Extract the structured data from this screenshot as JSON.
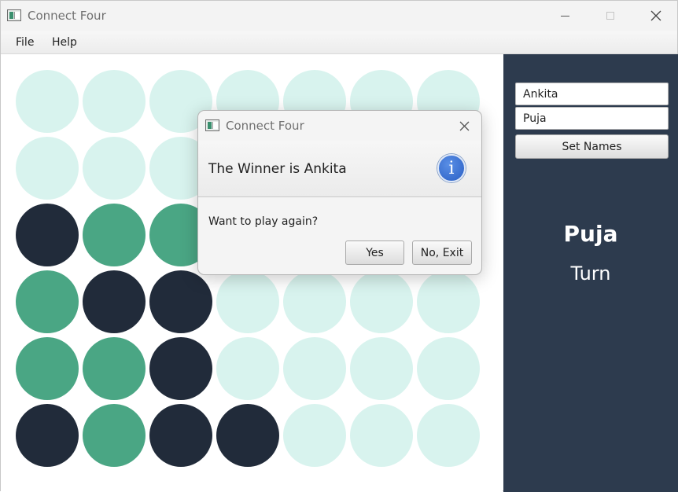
{
  "window": {
    "title": "Connect Four",
    "minimize_icon": "minimize-icon",
    "maximize_icon": "maximize-icon",
    "close_icon": "close-icon"
  },
  "menu": {
    "items": [
      {
        "label": "File"
      },
      {
        "label": "Help"
      }
    ]
  },
  "board": {
    "rows": 6,
    "columns": 7,
    "cells": [
      [
        "empty",
        "empty",
        "empty",
        "empty",
        "empty",
        "empty",
        "empty"
      ],
      [
        "empty",
        "empty",
        "empty",
        "empty",
        "empty",
        "empty",
        "empty"
      ],
      [
        "dark",
        "green",
        "green",
        "empty",
        "empty",
        "empty",
        "empty"
      ],
      [
        "green",
        "dark",
        "dark",
        "empty",
        "empty",
        "empty",
        "empty"
      ],
      [
        "green",
        "green",
        "dark",
        "empty",
        "empty",
        "empty",
        "empty"
      ],
      [
        "dark",
        "green",
        "dark",
        "dark",
        "empty",
        "empty",
        "empty"
      ]
    ],
    "colors": {
      "empty": "#d8f3ee",
      "green": "#4aa684",
      "dark": "#212b3a"
    }
  },
  "side_panel": {
    "player_one_value": "Ankita",
    "player_two_value": "Puja",
    "set_names_label": "Set Names",
    "current_player": "Puja",
    "turn_label": "Turn",
    "background": "#2d3b4e"
  },
  "dialog": {
    "title": "Connect Four",
    "header_text": "The Winner is Ankita",
    "info_icon_glyph": "i",
    "body_text": "Want to play again?",
    "yes_label": "Yes",
    "no_label": "No, Exit"
  }
}
